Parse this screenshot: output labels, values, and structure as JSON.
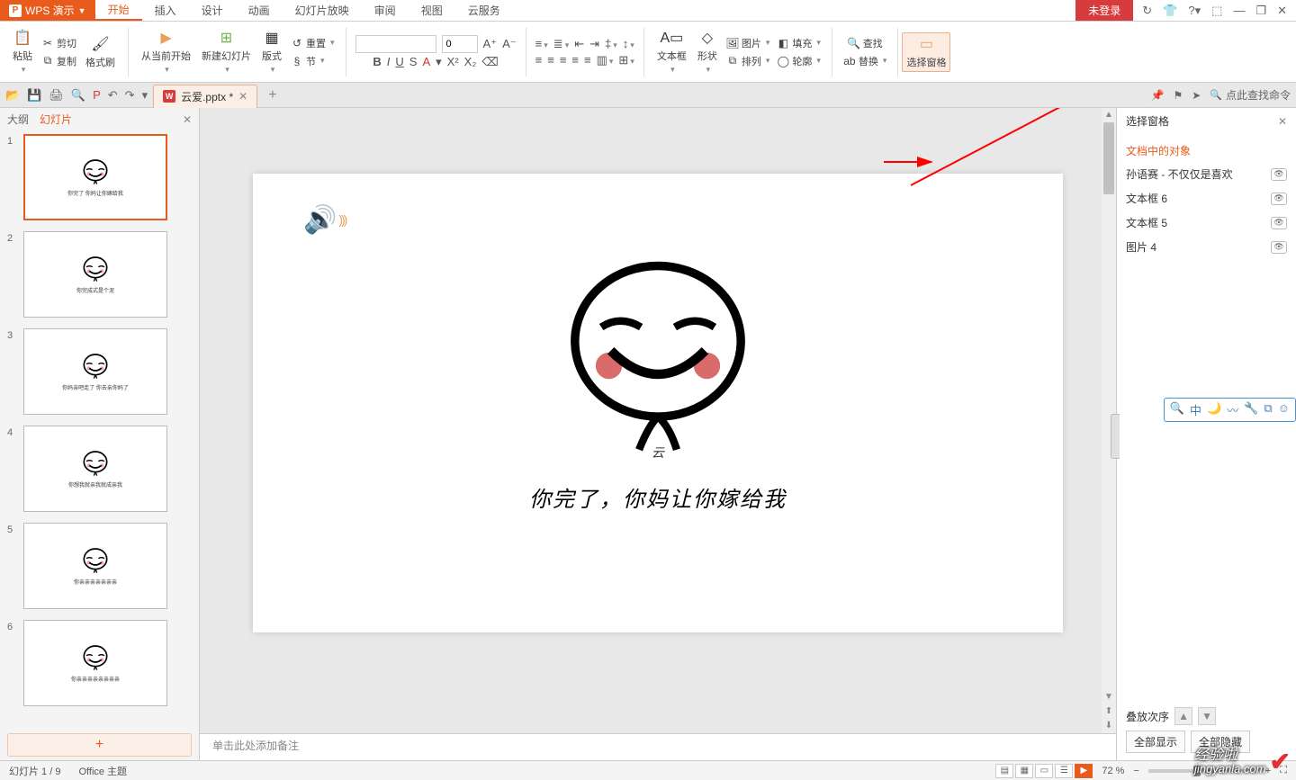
{
  "app": {
    "name": "WPS 演示",
    "login": "未登录"
  },
  "tabs": [
    "开始",
    "插入",
    "设计",
    "动画",
    "幻灯片放映",
    "审阅",
    "视图",
    "云服务"
  ],
  "activeTab": 0,
  "winIcons": [
    "↻",
    "👕",
    "?▾",
    "⬚",
    "—",
    "❐",
    "✕"
  ],
  "ribbon": {
    "paste": "粘贴",
    "cut": "剪切",
    "copy": "复制",
    "fmt": "格式刷",
    "fromCurrent": "从当前开始",
    "newSlide": "新建幻灯片",
    "layout": "版式",
    "reset": "重置",
    "section": "节",
    "font": "",
    "size": "0",
    "textbox": "文本框",
    "shape": "形状",
    "picture": "图片",
    "arrange": "排列",
    "fill": "填充",
    "outline": "轮廓",
    "find": "查找",
    "replace": "替换",
    "selectPane": "选择窗格"
  },
  "docTab": "云爱.pptx *",
  "searchPlaceholder": "点此查找命令",
  "leftPane": {
    "outline": "大纲",
    "slides": "幻灯片"
  },
  "thumbTexts": [
    "你完了 你妈让你嫁给我",
    "你完成式是个泥",
    "你妈亲吧走了 你去亲你妈了",
    "你想我就亲我就成亲我",
    "你亲亲亲亲亲亲亲",
    "你亲亲亲亲亲亲亲亲"
  ],
  "slideText": "你完了，你妈让你嫁给我",
  "yun": "云",
  "notesPlaceholder": "单击此处添加备注",
  "rightPane": {
    "title": "选择窗格",
    "sectionTitle": "文档中的对象",
    "items": [
      "孙语赛 - 不仅仅是喜欢",
      "文本框 6",
      "文本框 5",
      "图片 4"
    ],
    "order": "叠放次序",
    "showAll": "全部显示",
    "hideAll": "全部隐藏"
  },
  "status": {
    "page": "幻灯片 1 / 9",
    "theme": "Office 主题",
    "zoom": "72 %"
  },
  "watermark": {
    "line1": "经验啦",
    "line2": "jingyanla.com"
  }
}
